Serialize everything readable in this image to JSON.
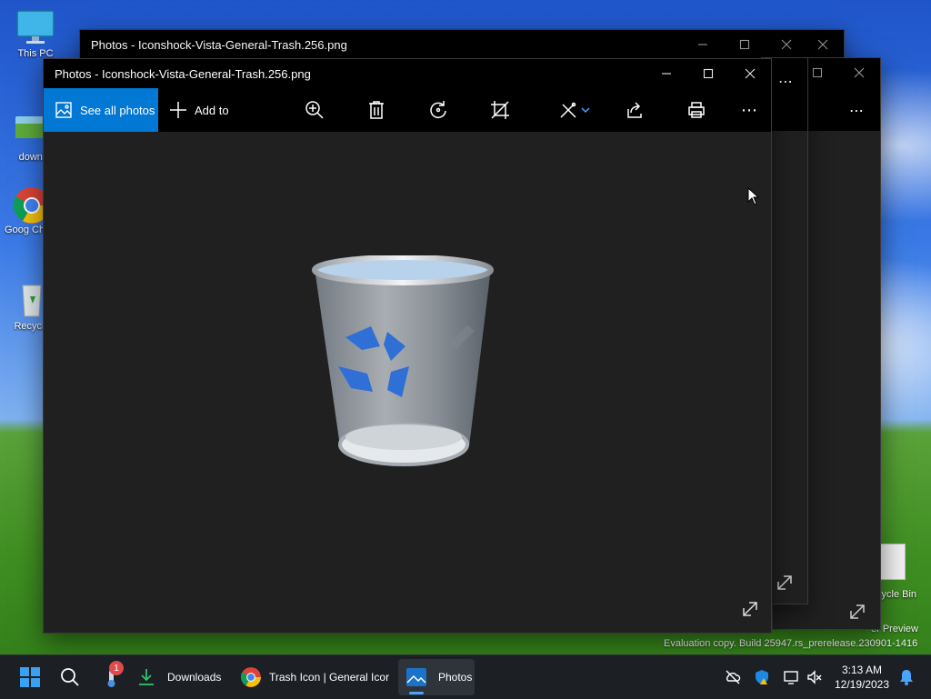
{
  "desktop": {
    "icons": [
      {
        "label": "This PC",
        "name": "this-pc"
      },
      {
        "label": "downl",
        "name": "downloads-folder"
      },
      {
        "label": "Goog Chron",
        "name": "google-chrome"
      },
      {
        "label": "Recycle",
        "name": "recycle-bin"
      }
    ],
    "right_icon_label": "cycle Bin",
    "watermark_line1": "er Preview",
    "watermark_line2": "Evaluation copy. Build 25947.rs_prerelease.230901-1416"
  },
  "back_window": {
    "title": "Photos - Iconshock-Vista-General-Trash.256.png"
  },
  "photos": {
    "title": "Photos - Iconshock-Vista-General-Trash.256.png",
    "see_all_label": "See all photos",
    "add_to_label": "Add to",
    "toolbar_icons": [
      "zoom-in-icon",
      "delete-icon",
      "rotate-icon",
      "crop-icon",
      "edit-icon",
      "share-icon",
      "print-icon",
      "more-icon"
    ],
    "image_subject": "recycle bin trash can",
    "accent_color": "#0078d4"
  },
  "taskbar": {
    "notification_badge": "1",
    "downloads_label": "Downloads",
    "chrome_label": "Trash Icon | General Icor",
    "photos_label": "Photos",
    "clock_time": "3:13 AM",
    "clock_date": "12/19/2023"
  }
}
